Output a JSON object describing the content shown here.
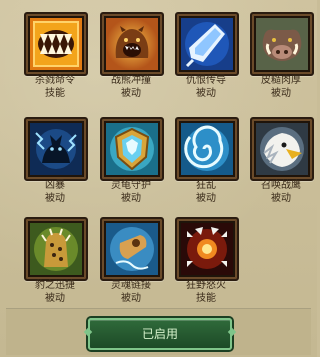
{
  "skills": [
    {
      "name": "杀戮命令",
      "type": "技能",
      "icon": "fanged-maw-icon"
    },
    {
      "name": "战熊冲撞",
      "type": "被动",
      "icon": "roaring-bear-icon"
    },
    {
      "name": "仇恨传导",
      "type": "被动",
      "icon": "blue-crystal-icon"
    },
    {
      "name": "皮糙肉厚",
      "type": "被动",
      "icon": "boar-head-icon"
    },
    {
      "name": "凶暴",
      "type": "被动",
      "icon": "electric-cat-icon"
    },
    {
      "name": "灵龟守护",
      "type": "被动",
      "icon": "turtle-shield-icon"
    },
    {
      "name": "狂乱",
      "type": "被动",
      "icon": "whirlwind-icon"
    },
    {
      "name": "召唤战鹰",
      "type": "被动",
      "icon": "eagle-head-icon"
    },
    {
      "name": "豹之迅捷",
      "type": "被动",
      "icon": "leopard-paw-icon"
    },
    {
      "name": "灵魂链接",
      "type": "被动",
      "icon": "soul-whistle-icon"
    },
    {
      "name": "狂野怒火",
      "type": "技能",
      "icon": "wild-fury-icon"
    }
  ],
  "footer": {
    "button_label": "已启用"
  },
  "colors": {
    "text": "#3a2b1a",
    "button": "#2f6a3a",
    "button_border": "#7fc58a"
  }
}
